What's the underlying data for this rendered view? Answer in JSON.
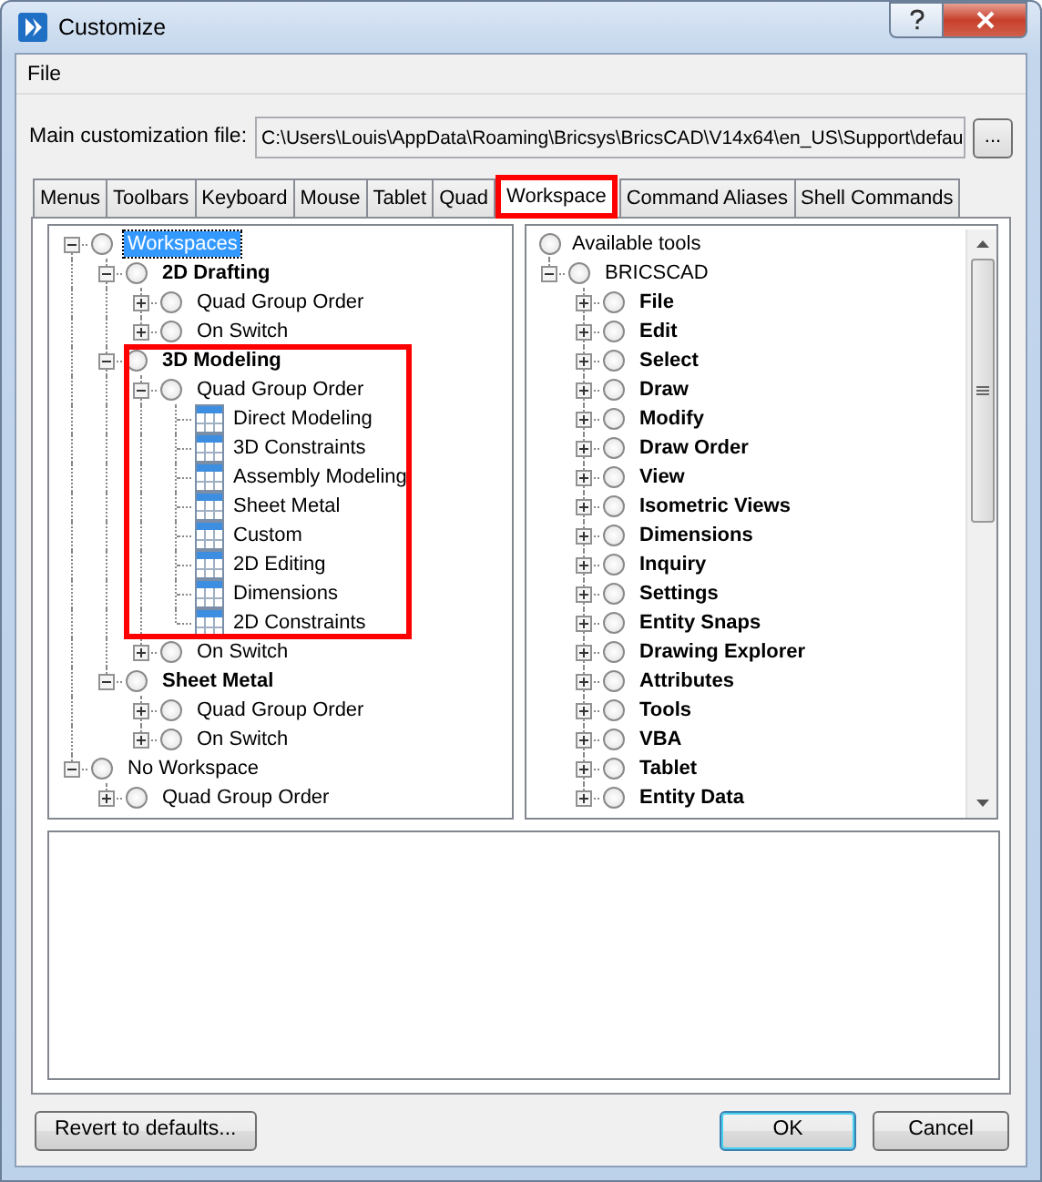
{
  "window": {
    "title": "Customize"
  },
  "menu": [
    {
      "label": "File"
    }
  ],
  "file_field": {
    "label": "Main customization file:",
    "value": "C:\\Users\\Louis\\AppData\\Roaming\\Bricsys\\BricsCAD\\V14x64\\en_US\\Support\\defau",
    "button": "..."
  },
  "tabs": [
    {
      "label": "Menus",
      "selected": false,
      "highlighted": false
    },
    {
      "label": "Toolbars",
      "selected": false,
      "highlighted": false
    },
    {
      "label": "Keyboard",
      "selected": false,
      "highlighted": false
    },
    {
      "label": "Mouse",
      "selected": false,
      "highlighted": false
    },
    {
      "label": "Tablet",
      "selected": false,
      "highlighted": false
    },
    {
      "label": "Quad",
      "selected": false,
      "highlighted": false
    },
    {
      "label": "Workspace",
      "selected": true,
      "highlighted": true
    },
    {
      "label": "Command Aliases",
      "selected": false,
      "highlighted": false
    },
    {
      "label": "Shell Commands",
      "selected": false,
      "highlighted": false
    }
  ],
  "workspace_tree": [
    {
      "label": "Workspaces",
      "kind": "branch",
      "expanded": true,
      "bold": false,
      "selected": true,
      "highlighted": false,
      "children": [
        {
          "label": "2D Drafting",
          "kind": "branch",
          "expanded": true,
          "bold": true,
          "selected": false,
          "highlighted": false,
          "children": [
            {
              "label": "Quad Group Order",
              "kind": "branch",
              "expanded": false,
              "bold": false,
              "selected": false,
              "highlighted": false
            },
            {
              "label": "On Switch",
              "kind": "branch",
              "expanded": false,
              "bold": false,
              "selected": false,
              "highlighted": false
            }
          ]
        },
        {
          "label": "3D Modeling",
          "kind": "branch",
          "expanded": true,
          "bold": true,
          "selected": false,
          "highlighted": true,
          "children": [
            {
              "label": "Quad Group Order",
              "kind": "branch",
              "expanded": true,
              "bold": false,
              "selected": false,
              "highlighted": true,
              "children": [
                {
                  "label": "Direct Modeling",
                  "kind": "leaf",
                  "bold": false,
                  "selected": false,
                  "highlighted": true
                },
                {
                  "label": "3D Constraints",
                  "kind": "leaf",
                  "bold": false,
                  "selected": false,
                  "highlighted": true
                },
                {
                  "label": "Assembly Modeling",
                  "kind": "leaf",
                  "bold": false,
                  "selected": false,
                  "highlighted": true
                },
                {
                  "label": "Sheet Metal",
                  "kind": "leaf",
                  "bold": false,
                  "selected": false,
                  "highlighted": true
                },
                {
                  "label": "Custom",
                  "kind": "leaf",
                  "bold": false,
                  "selected": false,
                  "highlighted": true
                },
                {
                  "label": "2D Editing",
                  "kind": "leaf",
                  "bold": false,
                  "selected": false,
                  "highlighted": true
                },
                {
                  "label": "Dimensions",
                  "kind": "leaf",
                  "bold": false,
                  "selected": false,
                  "highlighted": true
                },
                {
                  "label": "2D Constraints",
                  "kind": "leaf",
                  "bold": false,
                  "selected": false,
                  "highlighted": true
                }
              ]
            },
            {
              "label": "On Switch",
              "kind": "branch",
              "expanded": false,
              "bold": false,
              "selected": false,
              "highlighted": false
            }
          ]
        },
        {
          "label": "Sheet Metal",
          "kind": "branch",
          "expanded": true,
          "bold": true,
          "selected": false,
          "highlighted": false,
          "children": [
            {
              "label": "Quad Group Order",
              "kind": "branch",
              "expanded": false,
              "bold": false,
              "selected": false,
              "highlighted": false
            },
            {
              "label": "On Switch",
              "kind": "branch",
              "expanded": false,
              "bold": false,
              "selected": false,
              "highlighted": false
            }
          ]
        }
      ]
    },
    {
      "label": "No Workspace",
      "kind": "branch",
      "expanded": true,
      "bold": false,
      "selected": false,
      "highlighted": false,
      "children": [
        {
          "label": "Quad Group Order",
          "kind": "branch",
          "expanded": false,
          "bold": false,
          "selected": false,
          "highlighted": false
        }
      ]
    }
  ],
  "tools_tree": [
    {
      "label": "Available tools",
      "kind": "root",
      "bold": false
    },
    {
      "label": "BRICSCAD",
      "kind": "branch",
      "expanded": true,
      "bold": false,
      "children": [
        {
          "label": "File",
          "kind": "branch",
          "expanded": false,
          "bold": true
        },
        {
          "label": "Edit",
          "kind": "branch",
          "expanded": false,
          "bold": true
        },
        {
          "label": "Select",
          "kind": "branch",
          "expanded": false,
          "bold": true
        },
        {
          "label": "Draw",
          "kind": "branch",
          "expanded": false,
          "bold": true
        },
        {
          "label": "Modify",
          "kind": "branch",
          "expanded": false,
          "bold": true
        },
        {
          "label": "Draw Order",
          "kind": "branch",
          "expanded": false,
          "bold": true
        },
        {
          "label": "View",
          "kind": "branch",
          "expanded": false,
          "bold": true
        },
        {
          "label": "Isometric Views",
          "kind": "branch",
          "expanded": false,
          "bold": true
        },
        {
          "label": "Dimensions",
          "kind": "branch",
          "expanded": false,
          "bold": true
        },
        {
          "label": "Inquiry",
          "kind": "branch",
          "expanded": false,
          "bold": true
        },
        {
          "label": "Settings",
          "kind": "branch",
          "expanded": false,
          "bold": true
        },
        {
          "label": "Entity Snaps",
          "kind": "branch",
          "expanded": false,
          "bold": true
        },
        {
          "label": "Drawing Explorer",
          "kind": "branch",
          "expanded": false,
          "bold": true
        },
        {
          "label": "Attributes",
          "kind": "branch",
          "expanded": false,
          "bold": true
        },
        {
          "label": "Tools",
          "kind": "branch",
          "expanded": false,
          "bold": true
        },
        {
          "label": "VBA",
          "kind": "branch",
          "expanded": false,
          "bold": true
        },
        {
          "label": "Tablet",
          "kind": "branch",
          "expanded": false,
          "bold": true
        },
        {
          "label": "Entity Data",
          "kind": "branch",
          "expanded": false,
          "bold": true
        }
      ]
    }
  ],
  "footer": {
    "left_button": "Revert to defaults...",
    "buttons": [
      {
        "label": "OK",
        "default": true
      },
      {
        "label": "Cancel",
        "default": false
      }
    ]
  }
}
